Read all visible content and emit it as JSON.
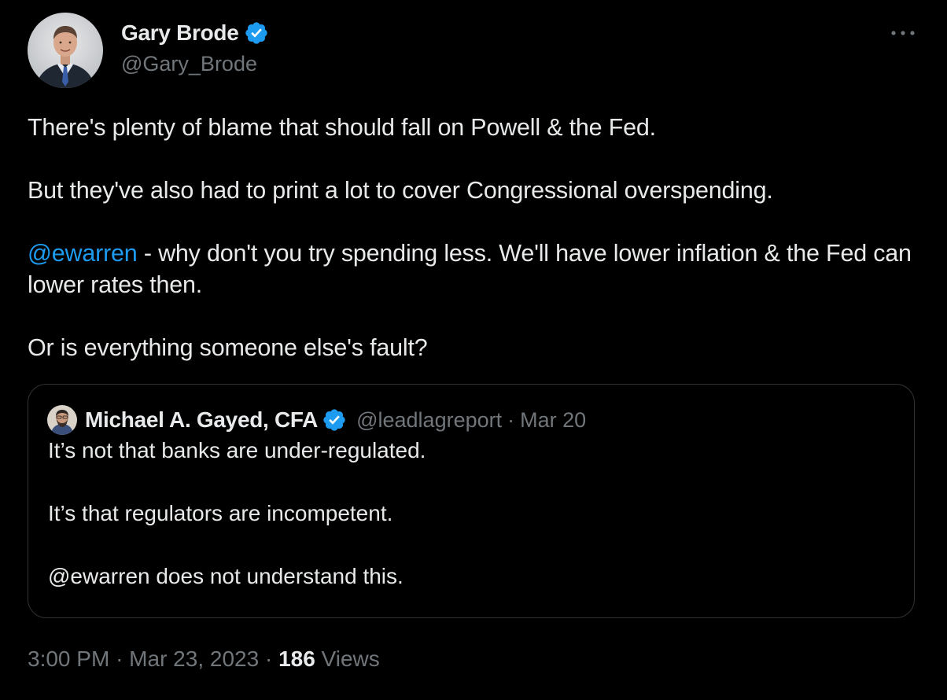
{
  "author": {
    "display_name": "Gary Brode",
    "handle": "@Gary_Brode",
    "verified": true,
    "avatar_icon": "profile-photo-man-in-suit"
  },
  "tweet": {
    "paragraphs": [
      "There's plenty of blame that should fall on Powell & the Fed.",
      "But they've also had to print a lot to cover Congressional overspending.",
      "",
      "Or is everything someone else's fault?"
    ],
    "mention": "@ewarren",
    "mention_paragraph_rest": " - why don't you try spending less. We'll have lower inflation & the Fed can lower rates then."
  },
  "quote": {
    "display_name": "Michael A. Gayed, CFA",
    "handle": "@leadlagreport",
    "separator": "·",
    "date": "Mar 20",
    "verified": true,
    "lines": [
      "It’s not that banks are under-regulated.",
      "It’s that regulators are incompetent.",
      "@ewarren does not understand this."
    ]
  },
  "meta": {
    "time": "3:00 PM",
    "separator": "·",
    "date": "Mar 23, 2023",
    "views_count": "186",
    "views_label": "Views"
  },
  "colors": {
    "background": "#000000",
    "text": "#e7e9ea",
    "secondary": "#71767b",
    "accent": "#1d9bf0",
    "border": "#2f3336"
  },
  "icons": {
    "verified": "verified-badge-icon",
    "more": "more-options-icon"
  }
}
